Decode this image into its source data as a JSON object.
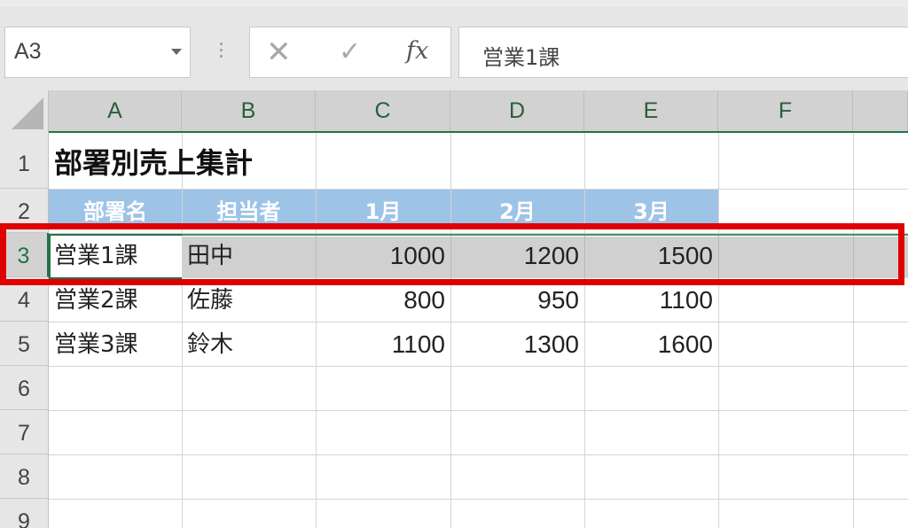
{
  "name_box": {
    "value": "A3"
  },
  "formula_bar": {
    "cancel_symbol": "✕",
    "confirm_symbol": "✓",
    "fx_label": "fx",
    "value": "営業1課"
  },
  "columns": [
    "A",
    "B",
    "C",
    "D",
    "E",
    "F"
  ],
  "rows": [
    "1",
    "2",
    "3",
    "4",
    "5",
    "6",
    "7",
    "8",
    "9"
  ],
  "cells": {
    "A1": "部署別売上集計",
    "A2": "部署名",
    "B2": "担当者",
    "C2": "1月",
    "D2": "2月",
    "E2": "3月",
    "A3": "営業1課",
    "B3": "田中",
    "C3": "1000",
    "D3": "1200",
    "E3": "1500",
    "A4": "営業2課",
    "B4": "佐藤",
    "C4": "800",
    "D4": "950",
    "E4": "1100",
    "A5": "営業3課",
    "B5": "鈴木",
    "C5": "1100",
    "D5": "1300",
    "E5": "1600"
  },
  "selection": {
    "active_cell": "A3",
    "selected_row": "3"
  },
  "colors": {
    "header_fill": "#9dc3e6",
    "selection_fill": "#d0d0d0",
    "excel_green": "#217346",
    "annotation_red": "#e00000"
  },
  "icons": {
    "cancel": "close-icon",
    "confirm": "checkmark-icon",
    "function": "function-icon",
    "dropdown": "chevron-down-icon",
    "select_all": "select-all-icon"
  }
}
